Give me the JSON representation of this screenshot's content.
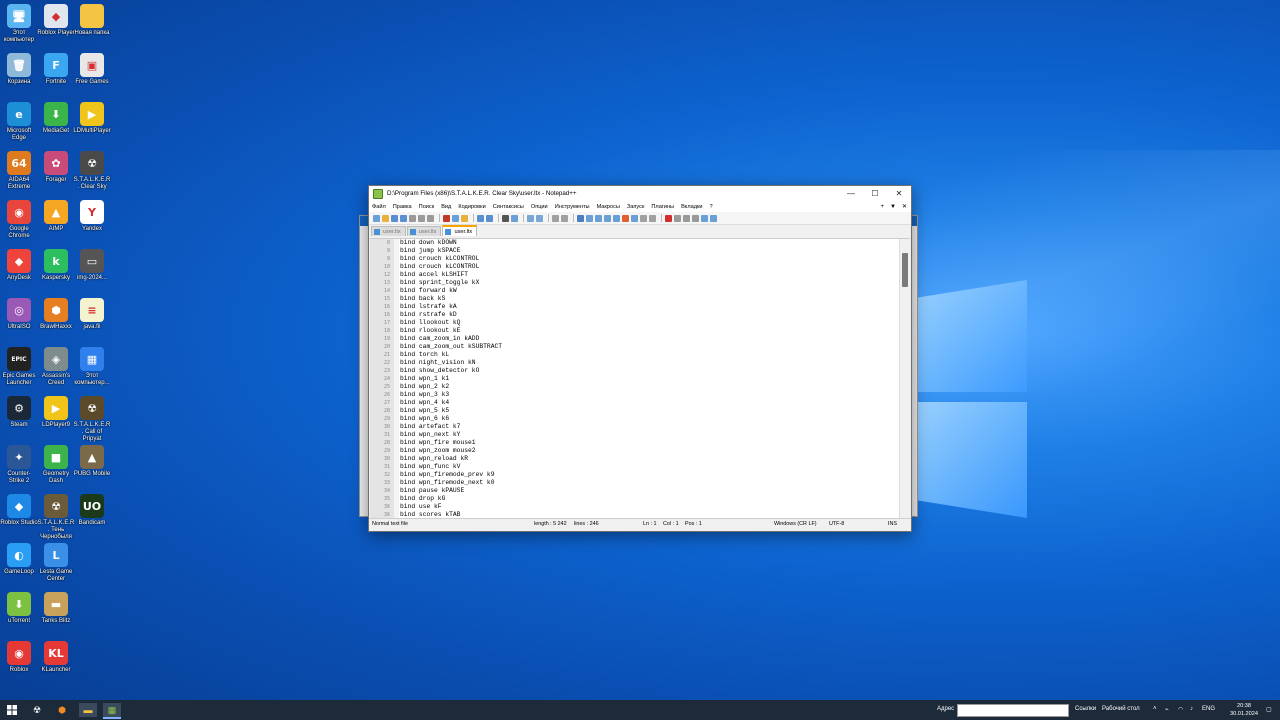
{
  "desktop": {
    "icons": [
      {
        "label": "Этот компьютер",
        "color": "#5ab4f0",
        "glyph": "🖥",
        "icon": "computer-icon"
      },
      {
        "label": "Roblox Player",
        "color": "#dfe6ee",
        "glyph": "◆",
        "icon": "roblox-icon"
      },
      {
        "label": "Новая папка",
        "color": "#f4c542",
        "glyph": "",
        "icon": "folder-icon"
      },
      {
        "label": "Корзина",
        "color": "#8fb9d8",
        "glyph": "🗑",
        "icon": "recycle-bin-icon"
      },
      {
        "label": "Fortnite",
        "color": "#3aa7f0",
        "glyph": "F",
        "icon": "fortnite-icon"
      },
      {
        "label": "Free Games",
        "color": "#e8e8e8",
        "glyph": "▣",
        "icon": "free-games-icon"
      },
      {
        "label": "Microsoft Edge",
        "color": "#1d8fd6",
        "glyph": "e",
        "icon": "edge-icon"
      },
      {
        "label": "MediaGet",
        "color": "#3bb54a",
        "glyph": "⬇",
        "icon": "mediaget-icon"
      },
      {
        "label": "LDMultiPlayer",
        "color": "#f0c419",
        "glyph": "▶",
        "icon": "ldmultiplayer-icon"
      },
      {
        "label": "AIDA64 Extreme",
        "color": "#e07a1f",
        "glyph": "64",
        "icon": "aida64-icon"
      },
      {
        "label": "Forager",
        "color": "#c94b7a",
        "glyph": "✿",
        "icon": "forager-icon"
      },
      {
        "label": "S.T.A.L.K.E.R. Clear Sky",
        "color": "#4a4a4a",
        "glyph": "☢",
        "icon": "stalker-icon"
      },
      {
        "label": "Google Chrome",
        "color": "#e8453c",
        "glyph": "◉",
        "icon": "chrome-icon"
      },
      {
        "label": "AIMP",
        "color": "#f5a623",
        "glyph": "▲",
        "icon": "aimp-icon"
      },
      {
        "label": "Yandex",
        "color": "#ffffff",
        "glyph": "Y",
        "icon": "yandex-icon"
      },
      {
        "label": "AnyDesk",
        "color": "#ef443b",
        "glyph": "◆",
        "icon": "anydesk-icon"
      },
      {
        "label": "Kaspersky",
        "color": "#2dbe60",
        "glyph": "k",
        "icon": "kaspersky-icon"
      },
      {
        "label": "img-2024...",
        "color": "#555555",
        "glyph": "▭",
        "icon": "keyboard-icon"
      },
      {
        "label": "UltraISO",
        "color": "#9b59b6",
        "glyph": "◎",
        "icon": "ultraiso-icon"
      },
      {
        "label": "BrawlHaxxx",
        "color": "#e67e22",
        "glyph": "⬢",
        "icon": "network-icon"
      },
      {
        "label": "java.fil",
        "color": "#f3f3d0",
        "glyph": "≡",
        "icon": "file-icon"
      },
      {
        "label": "Epic Games Launcher",
        "color": "#222222",
        "glyph": "EPIC",
        "icon": "epic-games-icon"
      },
      {
        "label": "Assassin's Creed",
        "color": "#7f8c8d",
        "glyph": "◈",
        "icon": "game-icon"
      },
      {
        "label": "Этот компьютер...",
        "color": "#2f80ed",
        "glyph": "▦",
        "icon": "shortcut-icon"
      },
      {
        "label": "Steam",
        "color": "#1b2838",
        "glyph": "⚙",
        "icon": "steam-icon"
      },
      {
        "label": "LDPlayer9",
        "color": "#f0c419",
        "glyph": "▶",
        "icon": "ldplayer-icon"
      },
      {
        "label": "S.T.A.L.K.E.R. Call of Pripyat",
        "color": "#5a4a2a",
        "glyph": "☢",
        "icon": "stalker-cop-icon"
      },
      {
        "label": "Counter-Strike 2",
        "color": "#2b5797",
        "glyph": "✦",
        "icon": "cs2-icon"
      },
      {
        "label": "Geometry Dash",
        "color": "#3cb44b",
        "glyph": "■",
        "icon": "geometry-dash-icon"
      },
      {
        "label": "PUBG Mobile",
        "color": "#7a6a4a",
        "glyph": "▲",
        "icon": "pubg-icon"
      },
      {
        "label": "Roblox Studio",
        "color": "#1e88e5",
        "glyph": "◆",
        "icon": "roblox-studio-icon"
      },
      {
        "label": "S.T.A.L.K.E.R. Тень Чернобыля",
        "color": "#6b5b3a",
        "glyph": "☢",
        "icon": "stalker-soc-icon"
      },
      {
        "label": "Bandicam",
        "color": "#1a3a1a",
        "glyph": "UO",
        "icon": "bandicam-icon"
      },
      {
        "label": "GameLoop",
        "color": "#2a9df4",
        "glyph": "◐",
        "icon": "gameloop-icon"
      },
      {
        "label": "Lesta Game Center",
        "color": "#3a8fe6",
        "glyph": "L",
        "icon": "lesta-icon"
      },
      {
        "label": "uTorrent",
        "color": "#7cc142",
        "glyph": "⬇",
        "icon": "torrent-icon"
      },
      {
        "label": "Tanks Blitz",
        "color": "#c8a25a",
        "glyph": "▬",
        "icon": "tanks-icon"
      },
      {
        "label": "Roblox",
        "color": "#e53935",
        "glyph": "◉",
        "icon": "roblox-app-icon"
      },
      {
        "label": "KLauncher",
        "color": "#e53935",
        "glyph": "KL",
        "icon": "klauncher-icon"
      }
    ]
  },
  "notepad": {
    "title": "D:\\Program Files (x86)\\S.T.A.L.K.E.R. Clear Sky\\user.ltx - Notepad++",
    "menu": [
      "Файл",
      "Правка",
      "Поиск",
      "Вид",
      "Кодировки",
      "Синтаксисы",
      "Опции",
      "Инструменты",
      "Макросы",
      "Запуск",
      "Плагины",
      "Вкладки",
      "?"
    ],
    "menu_right": [
      "+",
      "▼",
      "✕"
    ],
    "tabs": [
      {
        "label": "user.ltx",
        "active": false
      },
      {
        "label": "user.ltx",
        "active": false
      },
      {
        "label": "user.ltx",
        "active": true
      }
    ],
    "lines": [
      {
        "n": "8",
        "t": "bind down kDOWN"
      },
      {
        "n": "9",
        "t": "bind jump kSPACE"
      },
      {
        "n": "9",
        "t": "bind crouch kLCONTROL"
      },
      {
        "n": "10",
        "t": "bind crouch kLCONTROL"
      },
      {
        "n": "12",
        "t": "bind accel kLSHIFT"
      },
      {
        "n": "13",
        "t": "bind sprint_toggle kX"
      },
      {
        "n": "14",
        "t": "bind forward kW"
      },
      {
        "n": "15",
        "t": "bind back kS"
      },
      {
        "n": "16",
        "t": "bind lstrafe kA"
      },
      {
        "n": "16",
        "t": "bind rstrafe kD"
      },
      {
        "n": "17",
        "t": "bind llookout kQ"
      },
      {
        "n": "18",
        "t": "bind rlookout kE"
      },
      {
        "n": "19",
        "t": "bind cam_zoom_in kADD"
      },
      {
        "n": "20",
        "t": "bind cam_zoom_out kSUBTRACT"
      },
      {
        "n": "21",
        "t": "bind torch kL"
      },
      {
        "n": "22",
        "t": "bind night_vision kN"
      },
      {
        "n": "23",
        "t": "bind show_detector kO"
      },
      {
        "n": "24",
        "t": "bind wpn_1 k1"
      },
      {
        "n": "25",
        "t": "bind wpn_2 k2"
      },
      {
        "n": "26",
        "t": "bind wpn_3 k3"
      },
      {
        "n": "27",
        "t": "bind wpn_4 k4"
      },
      {
        "n": "28",
        "t": "bind wpn_5 k5"
      },
      {
        "n": "29",
        "t": "bind wpn_6 k6"
      },
      {
        "n": "30",
        "t": "bind artefact k7"
      },
      {
        "n": "31",
        "t": "bind wpn_next kY"
      },
      {
        "n": "28",
        "t": "bind wpn_fire mouse1"
      },
      {
        "n": "29",
        "t": "bind wpn_zoom mouse2"
      },
      {
        "n": "30",
        "t": "bind wpn_reload kR"
      },
      {
        "n": "31",
        "t": "bind wpn_func kV"
      },
      {
        "n": "32",
        "t": "bind wpn_firemode_prev k9"
      },
      {
        "n": "33",
        "t": "bind wpn_firemode_next k0"
      },
      {
        "n": "34",
        "t": "bind pause kPAUSE"
      },
      {
        "n": "35",
        "t": "bind drop kG"
      },
      {
        "n": "36",
        "t": "bind use kF"
      },
      {
        "n": "36",
        "t": "bind scores kTAB"
      }
    ],
    "status": {
      "type": "Normal text file",
      "length": "length : 5 242",
      "lines": "lines : 246",
      "ln": "Ln : 1",
      "col": "Col : 1",
      "pos": "Pos : 1",
      "eol": "Windows (CR LF)",
      "enc": "UTF-8",
      "mode": "INS"
    }
  },
  "taskbar": {
    "address_label": "Адрес",
    "links_label": "Ссылки",
    "desktop_label": "Рабочий стол",
    "lang": "ENG",
    "time": "20:38",
    "date": "30.01.2024"
  },
  "colors": {
    "accent": "#0a63cf",
    "taskbar": "#1c2a3a",
    "tab_active_border": "#f7a400"
  }
}
